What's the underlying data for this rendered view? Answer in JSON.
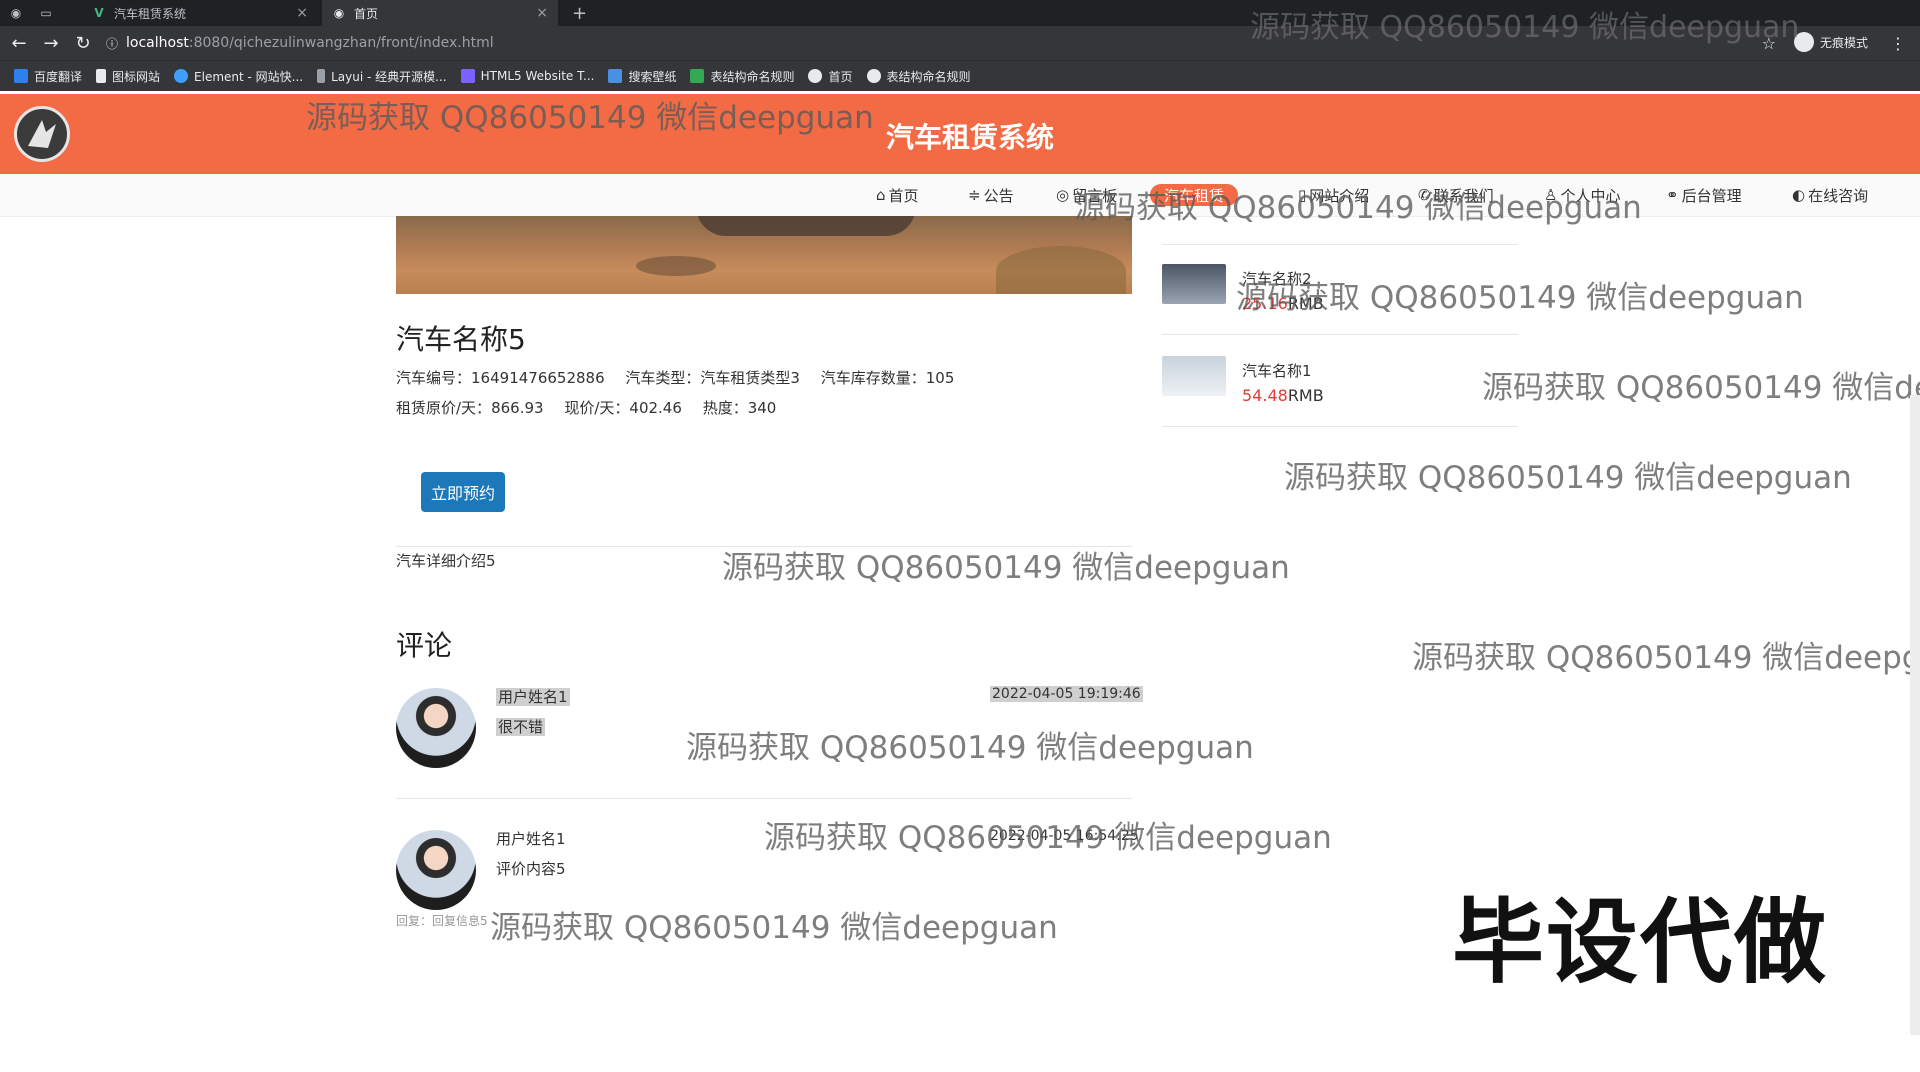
{
  "browser": {
    "tabs": [
      {
        "title": "汽车租赁系统",
        "active": false
      },
      {
        "title": "首页",
        "active": true
      }
    ],
    "url_host": "localhost",
    "url_path": ":8080/qichezulinwangzhan/front/index.html",
    "incognito_label": "无痕模式",
    "bookmarks": [
      "百度翻译",
      "图标网站",
      "Element - 网站快...",
      "Layui - 经典开源模...",
      "HTML5 Website T...",
      "搜索壁纸",
      "表结构命名规则",
      "首页",
      "表结构命名规则"
    ]
  },
  "header": {
    "title": "汽车租赁系统"
  },
  "menu": [
    "首页",
    "公告",
    "留言板",
    "汽车租赁",
    "网站介绍",
    "联系我们",
    "个人中心",
    "后台管理",
    "在线咨询"
  ],
  "car": {
    "name": "汽车名称5",
    "code_label": "汽车编号：",
    "code": "16491476652886",
    "type_label": "汽车类型：",
    "type": "汽车租赁类型3",
    "stock_label": "汽车库存数量：",
    "stock": "105",
    "orig_price_label": "租赁原价/天：",
    "orig_price": "866.93",
    "price_label": "现价/天：",
    "price": "402.46",
    "heat_label": "热度：",
    "heat": "340",
    "book_button": "立即预约",
    "detail": "汽车详细介绍5"
  },
  "comments_title": "评论",
  "comments": [
    {
      "user": "用户姓名1",
      "text": "很不错",
      "time": "2022-04-05 19:19:46",
      "reply": ""
    },
    {
      "user": "用户姓名1",
      "text": "评价内容5",
      "time": "2022-04-05 16:54:25",
      "reply": "回复：回复信息5"
    }
  ],
  "sidebar": [
    {
      "name": "汽车名称2",
      "price": "25.16",
      "unit": "RMB"
    },
    {
      "name": "汽车名称1",
      "price": "54.48",
      "unit": "RMB"
    }
  ],
  "watermarks": {
    "text": "源码获取 QQ86050149 微信deepguan",
    "big": "毕设代做"
  }
}
